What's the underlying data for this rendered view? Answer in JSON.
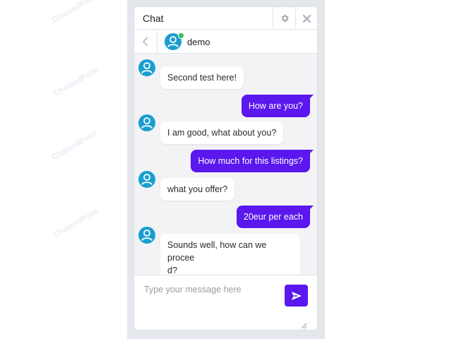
{
  "header": {
    "title": "Chat"
  },
  "conversation": {
    "contact_name": "demo",
    "status": "online"
  },
  "messages": [
    {
      "direction": "in",
      "text": "Second test here!"
    },
    {
      "direction": "out",
      "text": "How are you?"
    },
    {
      "direction": "in",
      "text": "I am good, what about you?"
    },
    {
      "direction": "out",
      "text": "How much for this listings?"
    },
    {
      "direction": "in",
      "text": "what you offer?"
    },
    {
      "direction": "out",
      "text": "20eur per each"
    },
    {
      "direction": "in",
      "text": "Sounds well, how can we procee\nd?"
    }
  ],
  "composer": {
    "placeholder": "Type your message here",
    "value": ""
  },
  "icons": {
    "settings": "gear-icon",
    "close": "close-icon",
    "back": "chevron-left-icon",
    "avatar": "user-avatar-icon",
    "send": "send-icon",
    "resize": "resize-grip-icon"
  },
  "colors": {
    "accent": "#5a17ee",
    "avatar": "#1a9ed0",
    "online": "#2ec24f"
  }
}
